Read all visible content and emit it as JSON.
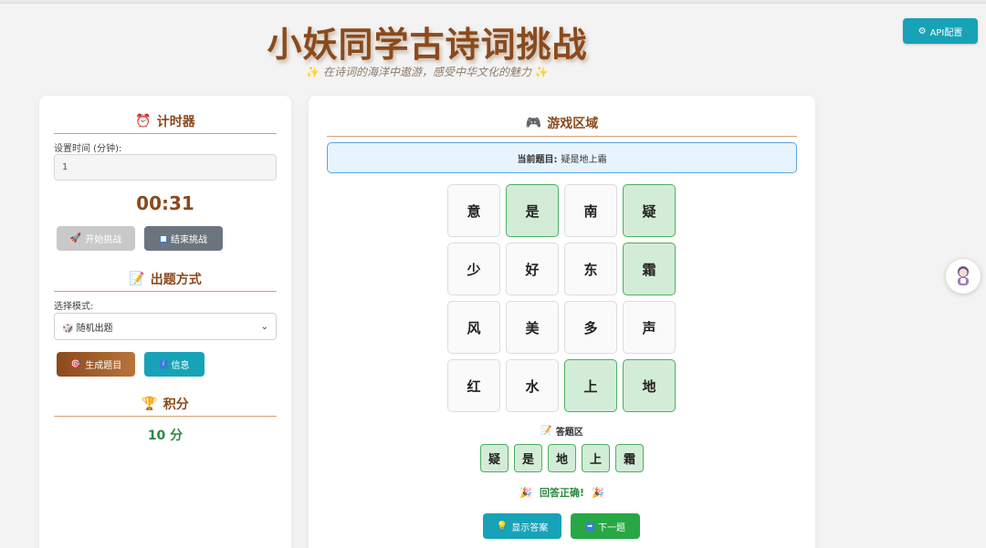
{
  "header": {
    "title": "小妖同学古诗词挑战",
    "subtitle": "在诗词的海洋中遨游，感受中华文化的魅力",
    "api_button": "API配置"
  },
  "timer_section": {
    "heading": "计时器",
    "set_time_label": "设置时间 (分钟):",
    "set_time_value": "1",
    "countdown": "00:31",
    "start_button": "开始挑战",
    "end_button": "结束挑战"
  },
  "mode_section": {
    "heading": "出题方式",
    "select_label": "选择模式:",
    "selected_mode": "随机出题",
    "generate_button": "生成题目",
    "info_button": "信息"
  },
  "score_section": {
    "heading": "积分",
    "score": "10 分"
  },
  "game": {
    "heading": "游戏区域",
    "question_label": "当前题目:",
    "question_text": "疑是地上霜",
    "grid": [
      {
        "char": "意",
        "selected": false
      },
      {
        "char": "是",
        "selected": true
      },
      {
        "char": "南",
        "selected": false
      },
      {
        "char": "疑",
        "selected": true
      },
      {
        "char": "少",
        "selected": false
      },
      {
        "char": "好",
        "selected": false
      },
      {
        "char": "东",
        "selected": false
      },
      {
        "char": "霜",
        "selected": true
      },
      {
        "char": "风",
        "selected": false
      },
      {
        "char": "美",
        "selected": false
      },
      {
        "char": "多",
        "selected": false
      },
      {
        "char": "声",
        "selected": false
      },
      {
        "char": "红",
        "selected": false
      },
      {
        "char": "水",
        "selected": false
      },
      {
        "char": "上",
        "selected": true
      },
      {
        "char": "地",
        "selected": true
      }
    ],
    "answer_label": "答题区",
    "answer": [
      "疑",
      "是",
      "地",
      "上",
      "霜"
    ],
    "result": "回答正确!",
    "show_answer_button": "显示答案",
    "next_button": "下一题"
  },
  "colors": {
    "brand_brown": "#8a4a1c",
    "info_teal": "#17a2b8",
    "success_green": "#28a745",
    "selected_cell": "#d3ecd7"
  }
}
